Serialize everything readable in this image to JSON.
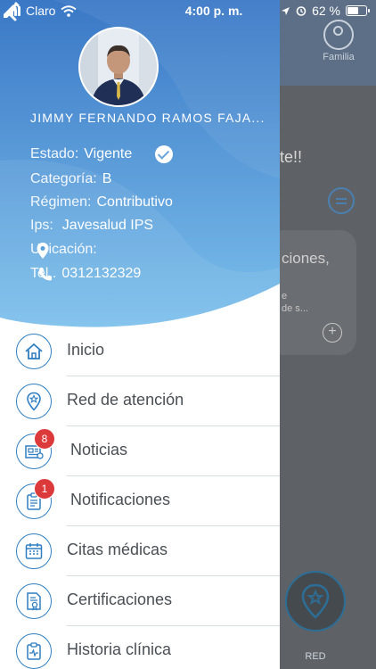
{
  "status_bar": {
    "carrier": "Claro",
    "time": "4:00 p. m.",
    "battery": "62 %",
    "battery_level": 0.62
  },
  "background": {
    "familia_label": "Familia",
    "greeting_fragment": "te!!",
    "card_title_fragment": "ciones,",
    "card_text_line1": "e",
    "card_text_line2": "de s...",
    "red_label": "RED"
  },
  "drawer": {
    "user_name": "JIMMY FERNANDO RAMOS FAJA...",
    "info": {
      "estado_label": "Estado:",
      "estado_value": "Vigente",
      "categoria_label": "Categoría:",
      "categoria_value": "B",
      "regimen_label": "Régimen:",
      "regimen_value": "Contributivo",
      "ips_label": "Ips:",
      "ips_value": "Javesalud IPS",
      "ubicacion_label": "Ubicación:",
      "tel_label": "Tel..",
      "tel_value": "0312132329"
    },
    "menu": [
      {
        "label": "Inicio",
        "icon": "home-icon"
      },
      {
        "label": "Red de atención",
        "icon": "map-pin-star-icon"
      },
      {
        "label": "Noticias",
        "icon": "newspaper-icon",
        "badge": "8"
      },
      {
        "label": "Notificaciones",
        "icon": "clipboard-icon",
        "badge": "1"
      },
      {
        "label": "Citas médicas",
        "icon": "calendar-icon"
      },
      {
        "label": "Certificaciones",
        "icon": "certificate-icon"
      },
      {
        "label": "Historia clínica",
        "icon": "medical-record-icon"
      }
    ]
  },
  "colors": {
    "accent": "#2f7ec1",
    "header_gradient_top": "#3a78c6",
    "header_gradient_bottom": "#7cc0ec",
    "badge": "#dc3a3a"
  }
}
